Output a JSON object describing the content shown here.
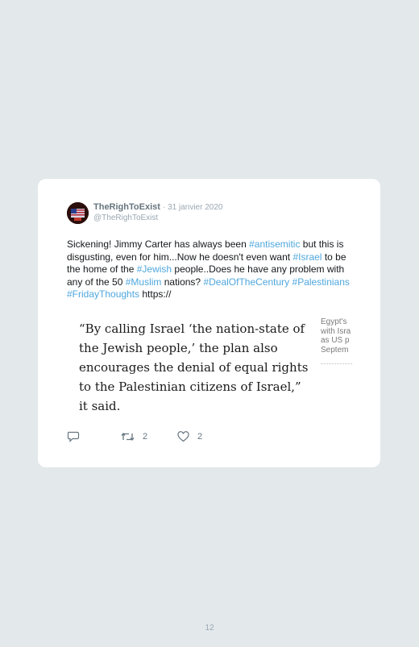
{
  "tweet": {
    "author_name": "TheRighToExist",
    "date": "· 31 janvier 2020",
    "handle": "@TheRighToExist",
    "text_segments": [
      {
        "text": "Sickening! Jimmy Carter has always been ",
        "tag": false
      },
      {
        "text": "#antisemitic",
        "tag": true
      },
      {
        "text": " but this is disgusting, even for him...Now he doesn't even want ",
        "tag": false
      },
      {
        "text": "#Israel",
        "tag": true
      },
      {
        "text": " to be the home of the ",
        "tag": false
      },
      {
        "text": "#Jewish",
        "tag": true
      },
      {
        "text": " people..Does he have any problem with any of the 50 ",
        "tag": false
      },
      {
        "text": "#Muslim",
        "tag": true
      },
      {
        "text": " nations? ",
        "tag": false
      },
      {
        "text": "#DealOfTheCentury",
        "tag": true
      },
      {
        "text": " ",
        "tag": false
      },
      {
        "text": "#Palestinians",
        "tag": true
      },
      {
        "text": " ",
        "tag": false
      },
      {
        "text": "#FridayThoughts",
        "tag": true
      },
      {
        "text": " https://",
        "tag": false
      }
    ],
    "quote": "“By calling Israel ‘the nation-state of the Jewish people,’ the plan also encourages the denial of equal rights to the Palestinian citizens of Israel,” it said.",
    "side_text_lines": [
      "Egypt's",
      "with Isra",
      "as US p",
      "Septem"
    ],
    "actions": {
      "reply_icon": "reply-icon",
      "retweet_icon": "retweet-icon",
      "retweet_count": "2",
      "like_icon": "heart-icon",
      "like_count": "2"
    }
  },
  "page_number": "12",
  "colors": {
    "background": "#e3e8eb",
    "card": "#ffffff",
    "hashtag": "#4fa7dd",
    "muted": "#9aa8b2"
  }
}
